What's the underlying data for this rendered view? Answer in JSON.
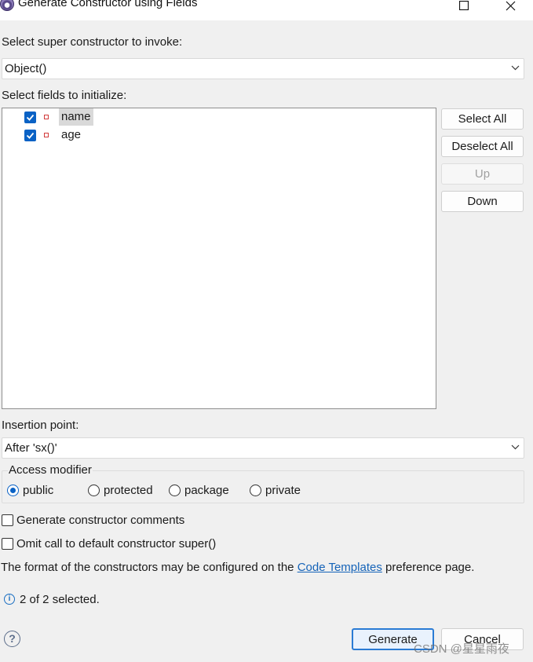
{
  "window": {
    "title": "Generate Constructor using Fields",
    "app_icon": "eclipse-icon",
    "controls": [
      "maximize-icon",
      "close-icon"
    ]
  },
  "super_constructor": {
    "label": "Select super constructor to invoke:",
    "value": "Object()"
  },
  "fields": {
    "label": "Select fields to initialize:",
    "items": [
      {
        "name": "name",
        "checked": true,
        "selected": true
      },
      {
        "name": "age",
        "checked": true,
        "selected": false
      }
    ]
  },
  "side_buttons": {
    "select_all": "Select All",
    "deselect_all": "Deselect All",
    "up": "Up",
    "down": "Down"
  },
  "insertion": {
    "label": "Insertion point:",
    "value": "After 'sx()'"
  },
  "access_modifier": {
    "title": "Access modifier",
    "options": [
      "public",
      "protected",
      "package",
      "private"
    ],
    "selected": "public"
  },
  "options": {
    "generate_comments": "Generate constructor comments",
    "omit_super": "Omit call to default constructor super()"
  },
  "format_note": {
    "prefix": "The format of the constructors may be configured on the ",
    "link": "Code Templates",
    "suffix": " preference page."
  },
  "status": "2 of 2 selected.",
  "buttons": {
    "generate": "Generate",
    "cancel": "Cancel"
  },
  "watermark": "CSDN @星星雨夜",
  "colors": {
    "accent": "#0a62c5",
    "link": "#1563b8",
    "field_icon": "#d23b3b"
  }
}
